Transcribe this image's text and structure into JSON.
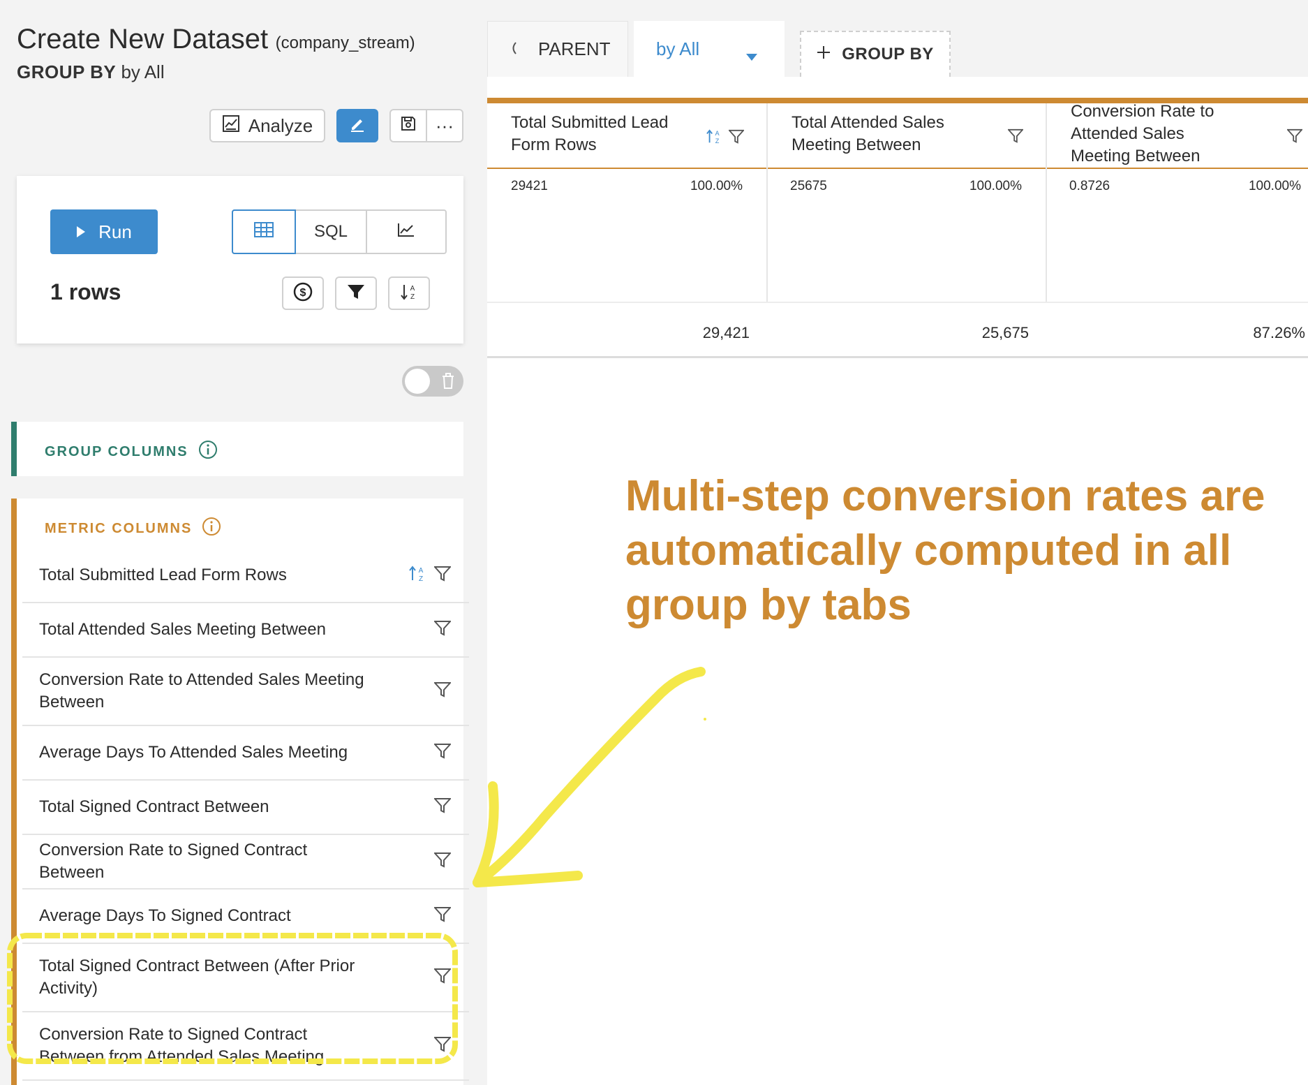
{
  "header": {
    "title": "Create New Dataset",
    "title_sub": "(company_stream)",
    "group_by_label": "GROUP BY",
    "group_by_value": "by All"
  },
  "toolbar": {
    "analyze_label": "Analyze",
    "more_label": "···"
  },
  "run_card": {
    "run_label": "Run",
    "sql_label": "SQL",
    "rows_label": "1 rows"
  },
  "group_columns": {
    "title": "GROUP COLUMNS"
  },
  "metric_columns": {
    "title": "METRIC COLUMNS",
    "items": [
      {
        "label": "Total Submitted Lead Form Rows"
      },
      {
        "label": "Total Attended Sales Meeting Between"
      },
      {
        "label": "Conversion Rate to Attended Sales Meeting Between"
      },
      {
        "label": "Average Days To Attended Sales Meeting"
      },
      {
        "label": "Total Signed Contract Between"
      },
      {
        "label": "Conversion Rate to Signed Contract Between"
      },
      {
        "label": "Average Days To Signed Contract"
      },
      {
        "label": "Total Signed Contract Between (After Prior Activity)"
      },
      {
        "label": "Conversion Rate to Signed Contract Between from Attended Sales Meeting"
      }
    ]
  },
  "tabs": {
    "parent_label": "PARENT",
    "active_label": "by All",
    "add_group_label": "GROUP BY"
  },
  "table": {
    "columns": [
      {
        "header": "Total Submitted Lead Form Rows",
        "value": "29421",
        "pct": "100.00%",
        "total": "29,421"
      },
      {
        "header": "Total Attended Sales Meeting Between",
        "value": "25675",
        "pct": "100.00%",
        "total": "25,675"
      },
      {
        "header": "Conversion Rate to Attended Sales Meeting Between",
        "value": "0.8726",
        "pct": "100.00%",
        "total": "87.26%"
      }
    ]
  },
  "annotation": {
    "text": "Multi-step conversion rates are automatically computed in all group by tabs"
  },
  "colors": {
    "accent_blue": "#3d8bcd",
    "accent_orange": "#cd8a32",
    "group_green": "#2f7d6d",
    "highlight_yellow": "#f4e84a"
  }
}
